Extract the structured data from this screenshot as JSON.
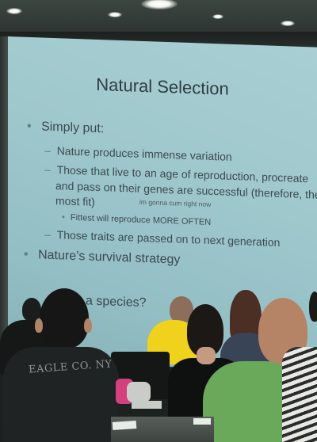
{
  "slide": {
    "title": "Natural Selection",
    "bullets": [
      {
        "marker": "•",
        "text": "Simply put:"
      },
      {
        "marker": "–",
        "text": "Nature produces immense variation"
      },
      {
        "marker": "–",
        "text": "Those that live to an age of reproduction, procreate"
      },
      {
        "text": "and pass on their genes are successful (therefore, the"
      },
      {
        "text": "most fit)"
      },
      {
        "text": "im gonna cum right now"
      },
      {
        "marker": "•",
        "text": "Fittest will reproduce MORE OFTEN"
      },
      {
        "marker": "–",
        "text": "Those traits are passed on to next generation"
      },
      {
        "marker": "•",
        "text": "Nature’s survival strategy"
      },
      {
        "text": "a species?"
      }
    ]
  },
  "audience": {
    "shirt_print": "EAGLE CO. NY"
  },
  "colors": {
    "slide_background": "#9fc8cd",
    "slide_text": "#3a4a50",
    "yellow_shirt": "#f0d21c",
    "green_shirt": "#6aa85a"
  }
}
